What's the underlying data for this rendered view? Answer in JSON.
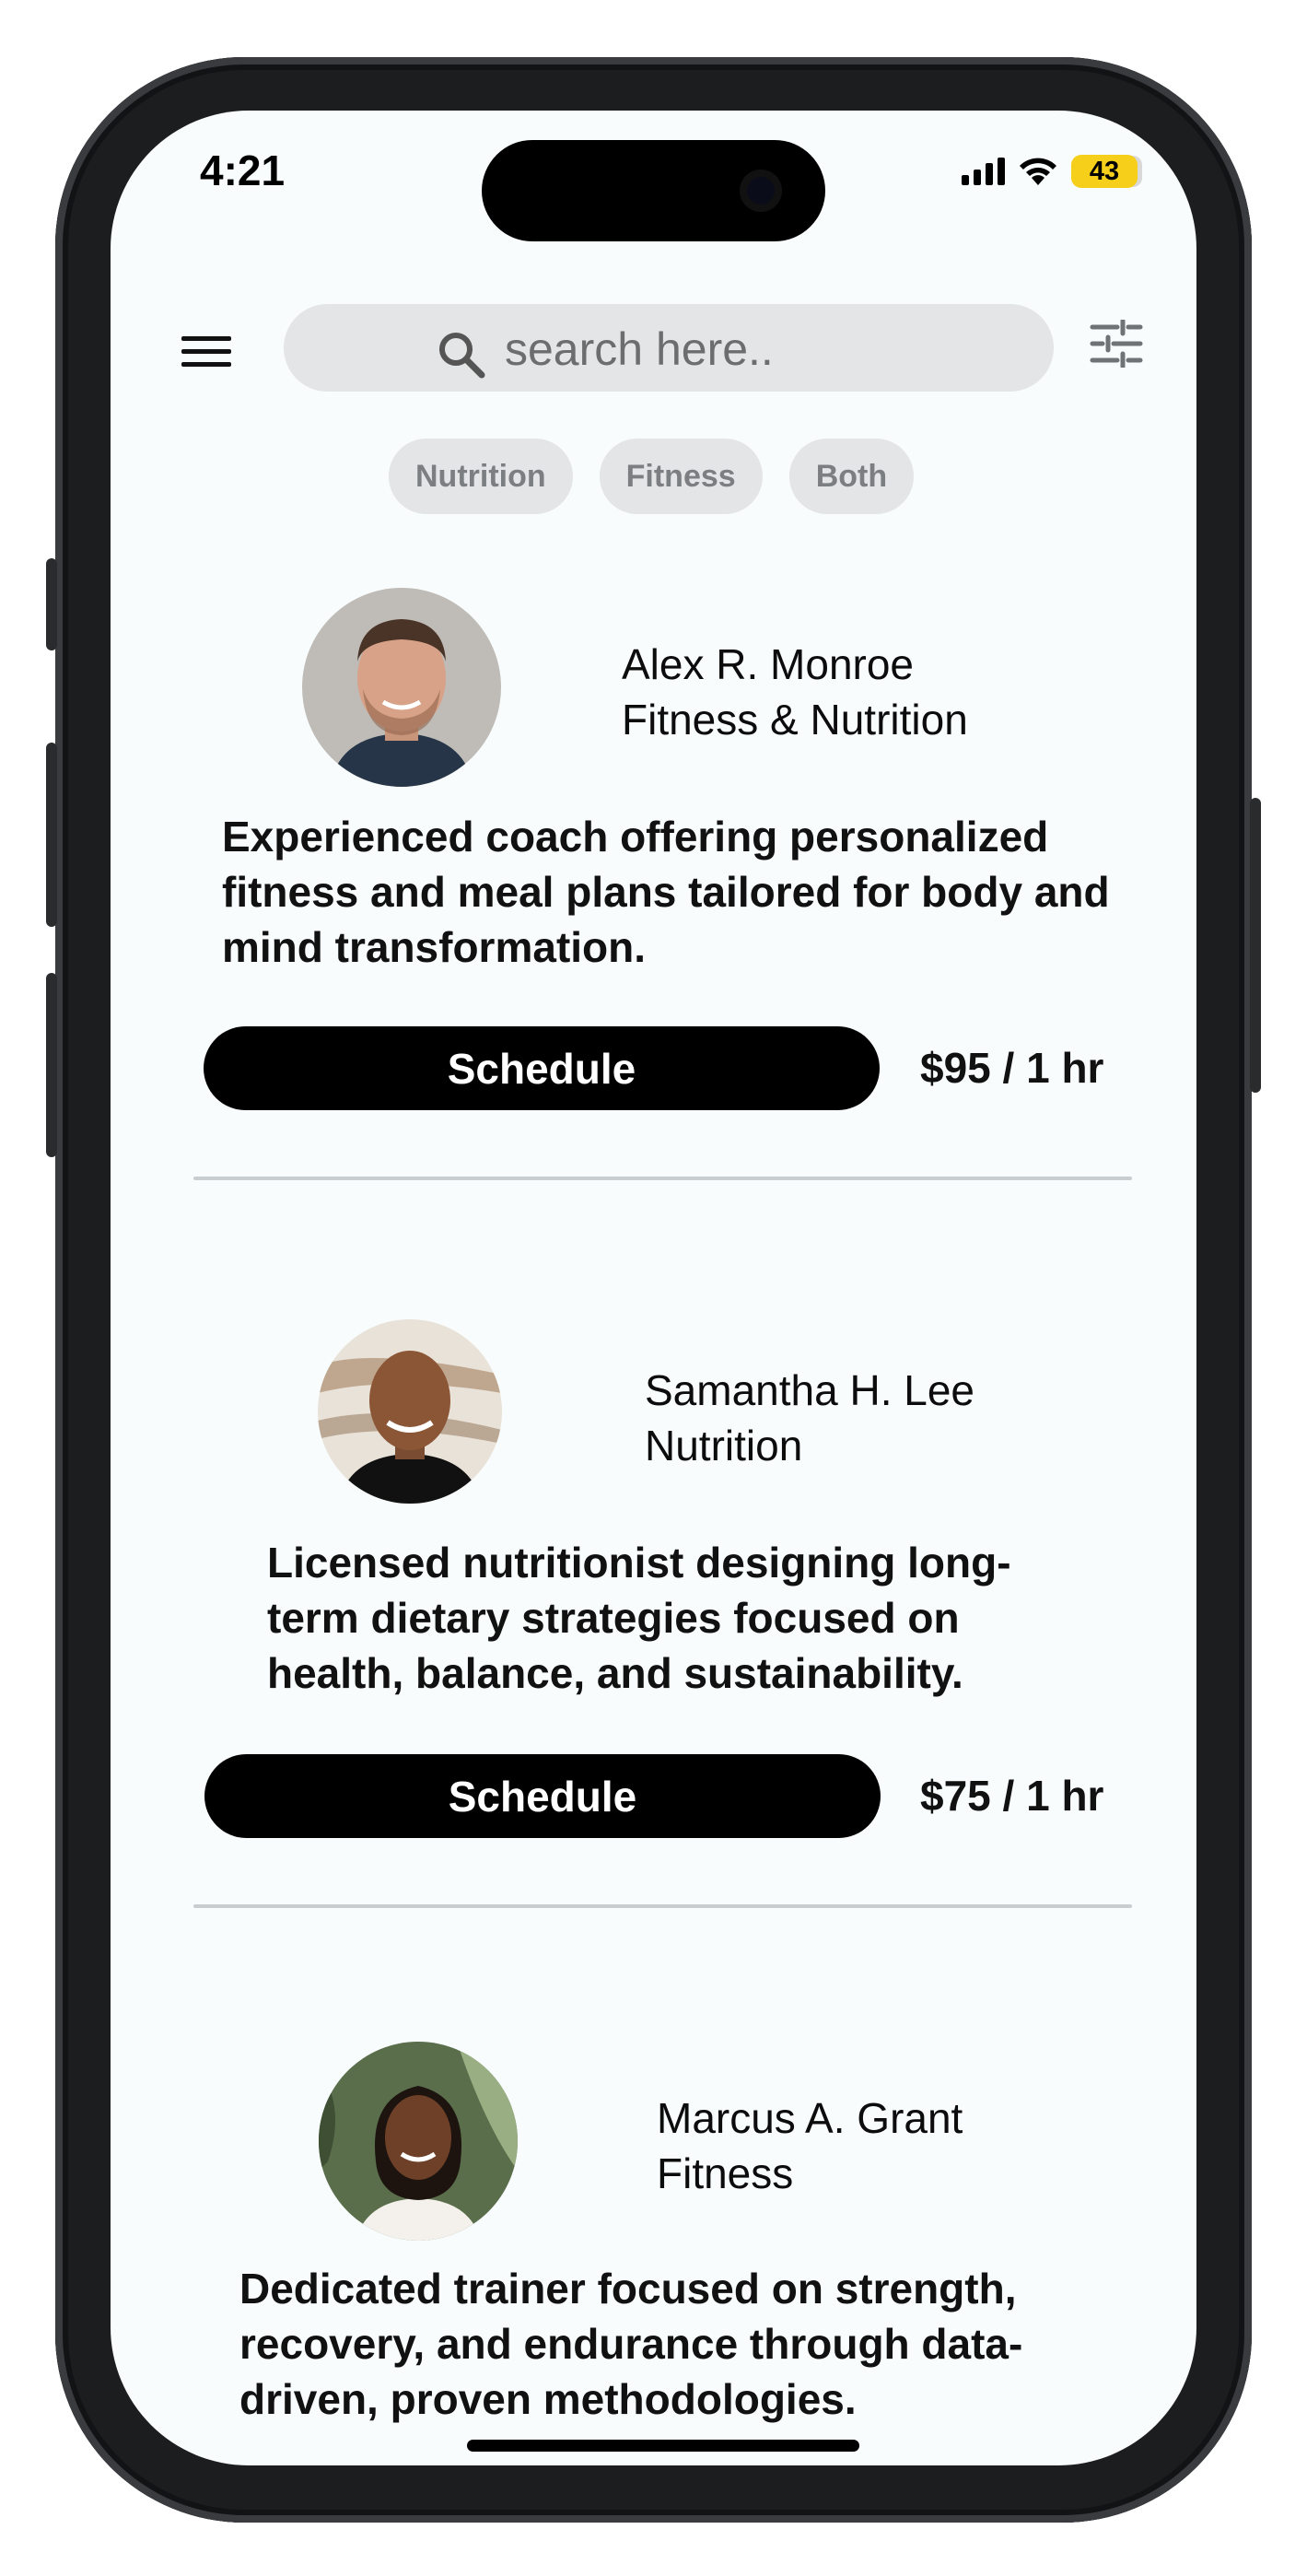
{
  "status_bar": {
    "time": "4:21",
    "battery": "43"
  },
  "search": {
    "placeholder": "search here.."
  },
  "filters": [
    "Nutrition",
    "Fitness",
    "Both"
  ],
  "coaches": [
    {
      "name": "Alex R. Monroe",
      "specialty": "Fitness & Nutrition",
      "description": "Experienced coach offering personalized fitness and meal plans tailored for body and mind transformation.",
      "button": "Schedule",
      "price": "$95 / 1 hr"
    },
    {
      "name": "Samantha H. Lee",
      "specialty": "Nutrition",
      "description": "Licensed nutritionist designing long-term dietary strategies focused on health, balance, and sustainability.",
      "button": "Schedule",
      "price": "$75 / 1 hr"
    },
    {
      "name": "Marcus A. Grant",
      "specialty": "Fitness",
      "description": "Dedicated trainer focused on strength, recovery, and endurance through data-driven, proven methodologies."
    }
  ],
  "icons": {
    "menu": "hamburger-icon",
    "search": "magnifier-icon",
    "filter": "sliders-icon"
  }
}
